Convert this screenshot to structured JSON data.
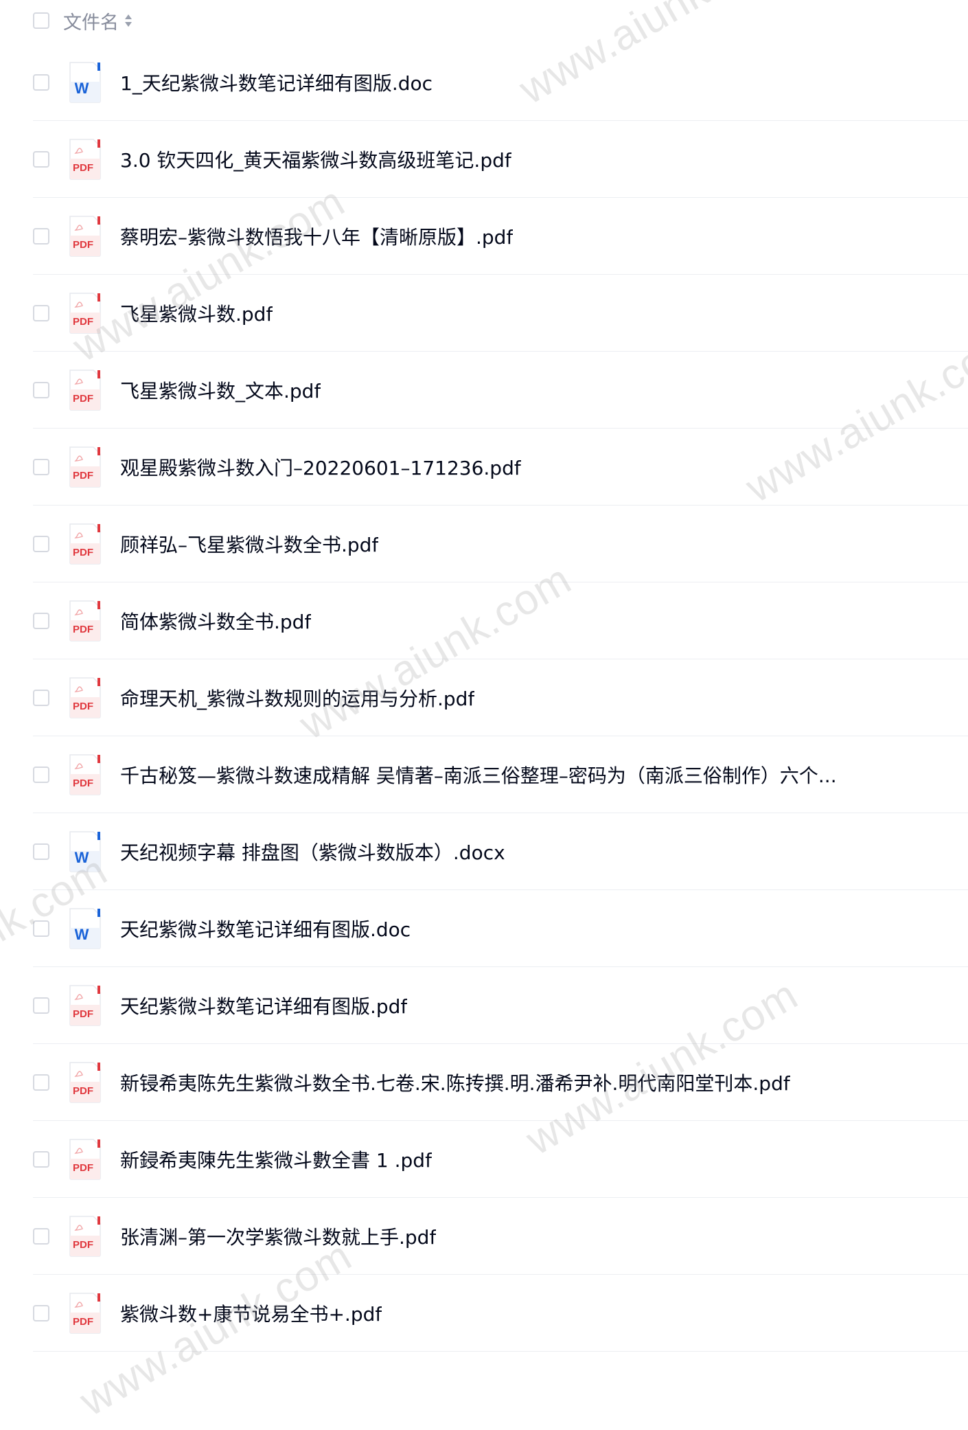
{
  "header": {
    "column_label": "文件名",
    "sort_icon": "sort-icon"
  },
  "files": [
    {
      "name": "1_天纪紫微斗数笔记详细有图版.doc",
      "type": "word"
    },
    {
      "name": "3.0 钦天四化_黄天福紫微斗数高级班笔记.pdf",
      "type": "pdf"
    },
    {
      "name": "蔡明宏–紫微斗数悟我十八年【清晰原版】.pdf",
      "type": "pdf"
    },
    {
      "name": "飞星紫微斗数.pdf",
      "type": "pdf"
    },
    {
      "name": "飞星紫微斗数_文本.pdf",
      "type": "pdf"
    },
    {
      "name": "观星殿紫微斗数入门–20220601–171236.pdf",
      "type": "pdf"
    },
    {
      "name": "顾祥弘–飞星紫微斗数全书.pdf",
      "type": "pdf"
    },
    {
      "name": "简体紫微斗数全书.pdf",
      "type": "pdf"
    },
    {
      "name": "命理天机_紫微斗数规则的运用与分析.pdf",
      "type": "pdf"
    },
    {
      "name": "千古秘笈—紫微斗数速成精解 吴情著–南派三俗整理–密码为（南派三俗制作）六个...",
      "type": "pdf"
    },
    {
      "name": "天纪视频字幕 排盘图（紫微斗数版本）.docx",
      "type": "word"
    },
    {
      "name": "天纪紫微斗数笔记详细有图版.doc",
      "type": "word"
    },
    {
      "name": "天纪紫微斗数笔记详细有图版.pdf",
      "type": "pdf"
    },
    {
      "name": "新锓希夷陈先生紫微斗数全书.七卷.宋.陈抟撰.明.潘希尹补.明代南阳堂刊本.pdf",
      "type": "pdf"
    },
    {
      "name": "新鋟希夷陳先生紫微斗數全書 1 .pdf",
      "type": "pdf"
    },
    {
      "name": "张清渊–第一次学紫微斗数就上手.pdf",
      "type": "pdf"
    },
    {
      "name": "紫微斗数+康节说易全书+.pdf",
      "type": "pdf"
    }
  ],
  "watermarks": [
    "www.aiunk.com",
    "www.aiunk.com",
    "www.aiunk.com",
    "www.aiunk.com",
    "nk.com",
    "www.aiunk.com",
    "www.aiunk.com"
  ],
  "colors": {
    "word_blue": "#1a63d8",
    "pdf_red": "#e0383e",
    "text": "#03081a",
    "header_text": "#878c9c"
  }
}
